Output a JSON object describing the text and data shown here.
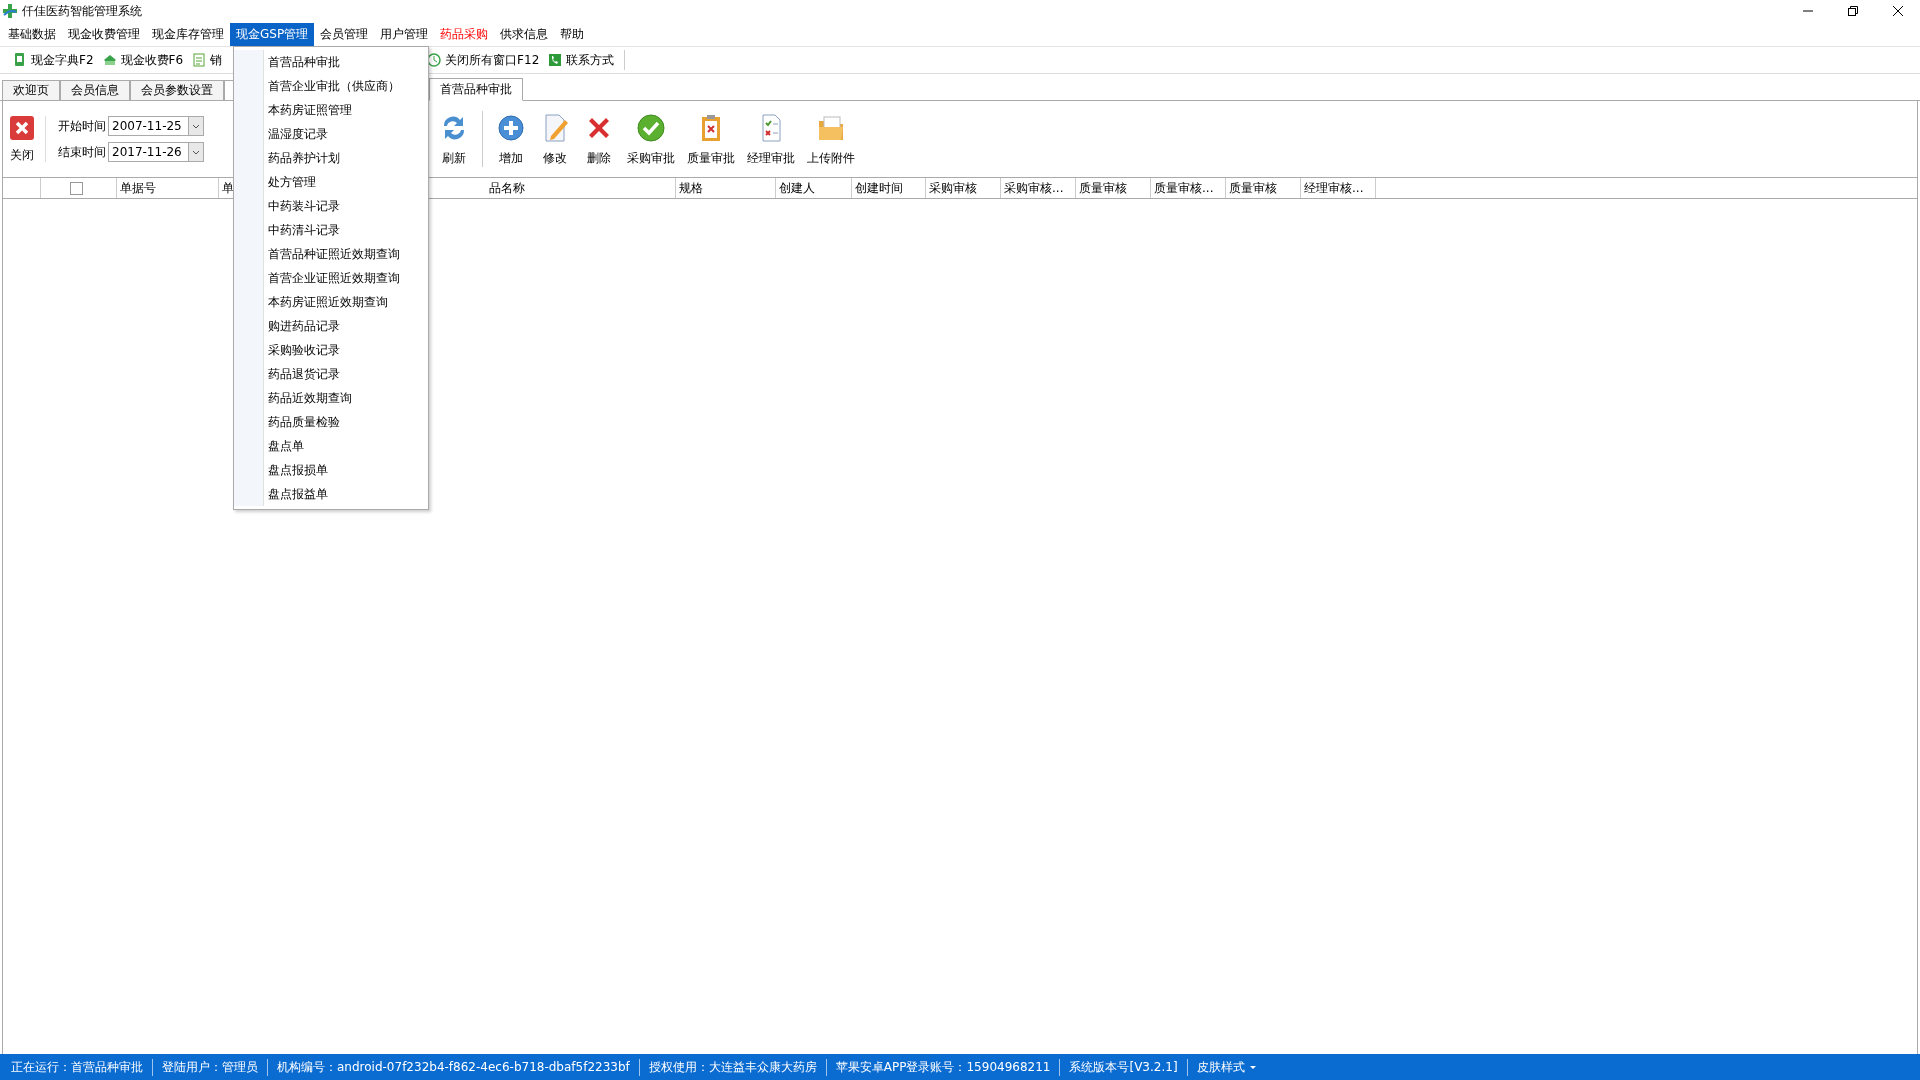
{
  "window": {
    "title": "仟佳医药智能管理系统"
  },
  "menu": [
    {
      "label": "基础数据",
      "selected": false,
      "highlighted": false
    },
    {
      "label": "现金收费管理",
      "selected": false,
      "highlighted": false
    },
    {
      "label": "现金库存管理",
      "selected": false,
      "highlighted": false
    },
    {
      "label": "现金GSP管理",
      "selected": true,
      "highlighted": false
    },
    {
      "label": "会员管理",
      "selected": false,
      "highlighted": false
    },
    {
      "label": "用户管理",
      "selected": false,
      "highlighted": false
    },
    {
      "label": "药品采购",
      "selected": false,
      "highlighted": true
    },
    {
      "label": "供求信息",
      "selected": false,
      "highlighted": false
    },
    {
      "label": "帮助",
      "selected": false,
      "highlighted": false
    }
  ],
  "dropdown": {
    "items": [
      "首营品种审批",
      "首营企业审批（供应商）",
      "本药房证照管理",
      "温湿度记录",
      "药品养护计划",
      "处方管理",
      "中药装斗记录",
      "中药清斗记录",
      "首营品种证照近效期查询",
      "首营企业证照近效期查询",
      "本药房证照近效期查询",
      "购进药品记录",
      "采购验收记录",
      "药品退货记录",
      "药品近效期查询",
      "药品质量检验",
      "盘点单",
      "盘点报损单",
      "盘点报益单"
    ]
  },
  "toolbar": {
    "left": [
      {
        "label": "现金字典F2",
        "kind": "dict"
      },
      {
        "label": "现金收费F6",
        "kind": "cash"
      },
      {
        "label": "销",
        "kind": "list"
      }
    ],
    "right": [
      {
        "label": "关闭所有窗口F12",
        "kind": "closeall"
      },
      {
        "label": "联系方式",
        "kind": "phone"
      }
    ]
  },
  "tabs": {
    "left": [
      {
        "label": "欢迎页",
        "selected": false
      },
      {
        "label": "会员信息",
        "selected": false
      },
      {
        "label": "会员参数设置",
        "selected": false
      }
    ],
    "right": [
      {
        "label": "首营品种审批",
        "selected": true
      }
    ]
  },
  "filter": {
    "close_label": "关闭",
    "start": {
      "label": "开始时间",
      "value": "2007-11-25"
    },
    "end": {
      "label": "结束时间",
      "value": "2017-11-26"
    }
  },
  "actions": [
    {
      "label": "刷新",
      "kind": "refresh"
    },
    {
      "label": "增加",
      "kind": "add"
    },
    {
      "label": "修改",
      "kind": "edit"
    },
    {
      "label": "删除",
      "kind": "delete"
    },
    {
      "label": "采购审批",
      "kind": "approve"
    },
    {
      "label": "质量审批",
      "kind": "quality"
    },
    {
      "label": "经理审批",
      "kind": "manager"
    },
    {
      "label": "上传附件",
      "kind": "upload"
    }
  ],
  "table": {
    "left_columns": [
      "单据号",
      "单"
    ],
    "right_columns": [
      "品名称",
      "规格",
      "创建人",
      "创建时间",
      "采购审核",
      "采购审核...",
      "质量审核",
      "质量审核...",
      "质量审核",
      "经理审核..."
    ],
    "select_all": {
      "checked": false
    }
  },
  "status_bar": [
    "正在运行：首营品种审批",
    "登陆用户：管理员",
    "机构编号：android-07f232b4-f862-4ec6-b718-dbaf5f2233bf",
    "授权使用：大连益丰众康大药房",
    "苹果安卓APP登录账号：15904968211",
    "系统版本号[V3.2.1]",
    "皮肤样式"
  ]
}
